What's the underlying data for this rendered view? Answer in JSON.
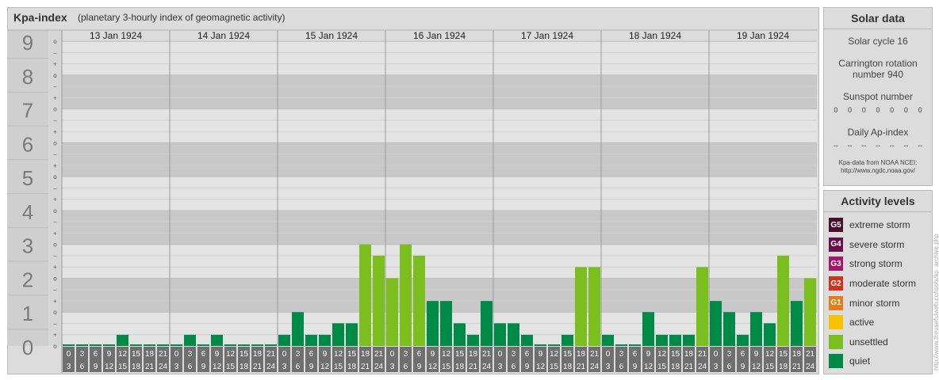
{
  "header": {
    "title": "Kpa-index",
    "subtitle": "(planetary 3-hourly index of geomagnetic activity)"
  },
  "chart_data": {
    "type": "bar",
    "title": "Kpa-index",
    "subtitle": "(planetary 3-hourly index of geomagnetic activity)",
    "ylim": [
      0,
      9.33
    ],
    "y_ticks": [
      "0",
      "1",
      "2",
      "3",
      "4",
      "5",
      "6",
      "7",
      "8",
      "9"
    ],
    "minor_tick_labels": [
      "+",
      "o",
      "–"
    ],
    "days": [
      "13 Jan 1924",
      "14 Jan 1924",
      "15 Jan 1924",
      "16 Jan 1924",
      "17 Jan 1924",
      "18 Jan 1924",
      "19 Jan 1924"
    ],
    "interval_labels": [
      [
        "0",
        "3"
      ],
      [
        "3",
        "6"
      ],
      [
        "6",
        "9"
      ],
      [
        "9",
        "12"
      ],
      [
        "12",
        "15"
      ],
      [
        "15",
        "18"
      ],
      [
        "18",
        "21"
      ],
      [
        "21",
        "24"
      ]
    ],
    "values": [
      [
        0,
        0,
        0,
        0,
        0.33,
        0,
        0,
        0
      ],
      [
        0,
        0.33,
        0,
        0.33,
        0,
        0,
        0,
        0
      ],
      [
        0.33,
        1,
        0.33,
        0.33,
        0.67,
        0.67,
        3,
        2.67
      ],
      [
        2,
        3,
        2.67,
        1.33,
        1.33,
        0.67,
        0.33,
        1.33
      ],
      [
        0.67,
        0.67,
        0.33,
        0,
        0,
        0.33,
        2.33,
        2.33
      ],
      [
        0.33,
        0,
        0,
        1,
        0.33,
        0.33,
        0.33,
        2.33
      ],
      [
        1.33,
        1,
        0.33,
        1,
        0.67,
        2.67,
        1.33,
        2
      ]
    ],
    "level_colors": {
      "quiet": "#008a47",
      "unsettled": "#7bbf1e"
    },
    "unsettled_threshold": 2,
    "grid": true
  },
  "solar": {
    "title": "Solar data",
    "cycle": "Solar cycle 16",
    "carrington_line1": "Carrington rotation",
    "carrington_line2": "number 940",
    "sunspot_title": "Sunspot number",
    "sunspots": [
      "0",
      "0",
      "0",
      "0",
      "0",
      "0",
      "0"
    ],
    "ap_title": "Daily Ap-index",
    "ap": [
      "--",
      "--",
      "--",
      "--",
      "--",
      "--",
      "--"
    ],
    "credit_line1": "Kpa-data from NOAA NCEI:",
    "credit_line2": "http://www.ngdc.noaa.gov/"
  },
  "activity": {
    "title": "Activity levels",
    "items": [
      {
        "badge": "G5",
        "label": "extreme storm",
        "color": "#4a0f2c"
      },
      {
        "badge": "G4",
        "label": "severe storm",
        "color": "#6b0f4a"
      },
      {
        "badge": "G3",
        "label": "strong storm",
        "color": "#a3166e"
      },
      {
        "badge": "G2",
        "label": "moderate storm",
        "color": "#d43218"
      },
      {
        "badge": "G1",
        "label": "minor storm",
        "color": "#e47d16"
      },
      {
        "badge": "",
        "label": "active",
        "color": "#f7c200"
      },
      {
        "badge": "",
        "label": "unsettled",
        "color": "#7bbf1e"
      },
      {
        "badge": "",
        "label": "quiet",
        "color": "#008a47"
      }
    ]
  },
  "watermark": "http://www.theusefulweb.co/tools/kp_archive.php"
}
